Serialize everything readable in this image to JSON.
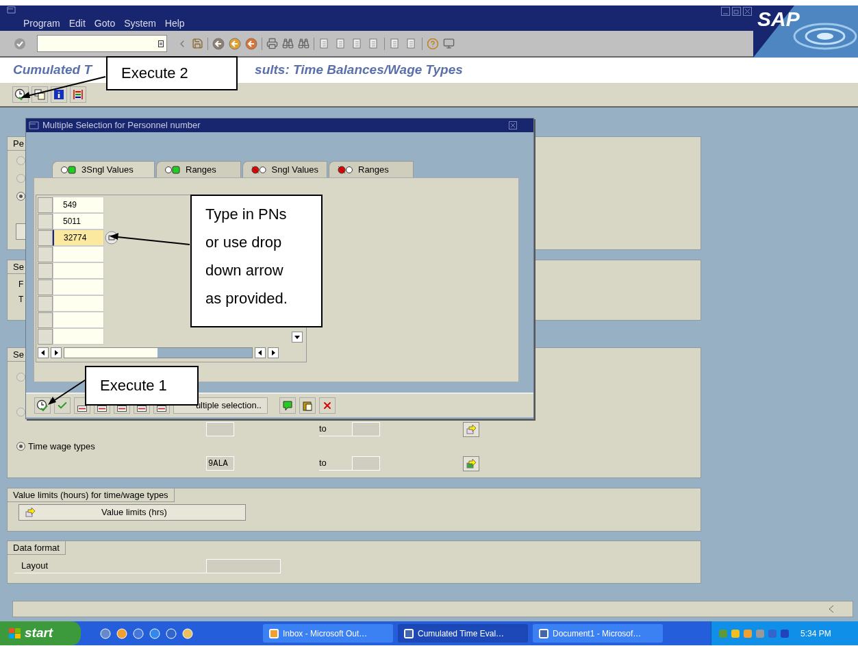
{
  "window": {
    "logo": "SAP"
  },
  "menu": [
    "Program",
    "Edit",
    "Goto",
    "System",
    "Help"
  ],
  "page_title": [
    "Cumulated T",
    "sults: Time Balances/Wage Types"
  ],
  "groups": [
    {
      "kind": "radios",
      "header": "Pe",
      "radios": [
        {
          "selected": false
        },
        {
          "selected": false
        },
        {
          "selected": true
        }
      ]
    },
    {
      "kind": "labels",
      "header": "Se",
      "labels": [
        "F",
        "T"
      ]
    },
    {
      "kind": "selection",
      "header": "Se",
      "items": [
        {
          "kind": "radio",
          "selected": false
        },
        {
          "kind": "radio",
          "selected": false
        },
        {
          "kind": "range",
          "to_label": "to",
          "color": "#e8d8f0"
        },
        {
          "kind": "radio",
          "selected": true,
          "label": "Time wage types"
        },
        {
          "kind": "range",
          "from": "9ALA",
          "to_label": "to",
          "color": "#3aa83a"
        }
      ]
    },
    {
      "kind": "button",
      "header": "Value limits (hours) for time/wage types",
      "button": "Value limits (hrs)"
    },
    {
      "kind": "field",
      "header": "Data format",
      "label": "Layout"
    }
  ],
  "dialog": {
    "title": "Multiple Selection for Personnel number",
    "tabs": [
      {
        "label": "3Sngl Values",
        "kind": "include",
        "selected": true
      },
      {
        "label": "Ranges",
        "kind": "include",
        "selected": false
      },
      {
        "label": "Sngl Values",
        "kind": "exclude",
        "selected": false
      },
      {
        "label": "Ranges",
        "kind": "exclude",
        "selected": false
      }
    ],
    "rows": [
      {
        "value": "549",
        "selected": false
      },
      {
        "value": "5011",
        "selected": false
      },
      {
        "value": "32774",
        "selected": true
      },
      {
        "selected": false
      },
      {
        "selected": false
      },
      {
        "selected": false
      },
      {
        "selected": false
      },
      {
        "selected": false
      },
      {
        "selected": false
      }
    ],
    "text_button": "ultiple selection.."
  },
  "callouts": [
    {
      "text": "Execute 2"
    },
    {
      "text": "Type in PNs or use drop down arrow as provided."
    },
    {
      "text": "Execute 1"
    }
  ],
  "taskbar": {
    "start": "start",
    "tasks": [
      {
        "label": "Inbox - Microsoft Out…",
        "selected": false
      },
      {
        "label": "Cumulated Time Eval…",
        "selected": true
      },
      {
        "label": "Document1 - Microsof…",
        "selected": false
      }
    ],
    "time": "5:34 PM"
  }
}
